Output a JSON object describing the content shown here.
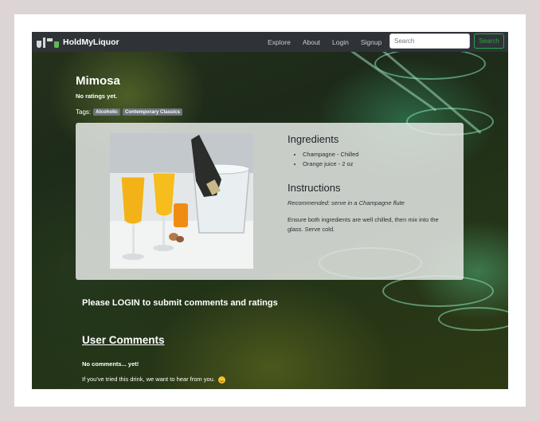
{
  "brand": {
    "name": "HoldMyLiquor",
    "icon": "cocktail-glasses-logo-icon"
  },
  "nav": {
    "links": [
      "Explore",
      "About",
      "Login",
      "Signup"
    ],
    "search_placeholder": "Search",
    "search_button": "Search"
  },
  "drink": {
    "name": "Mimosa",
    "ratings": "No ratings yet.",
    "tags_label": "Tags:",
    "tags": [
      "Alcoholic",
      "Contemporary Classics"
    ],
    "image_icon": "mimosa-photo"
  },
  "ingredients": {
    "heading": "Ingredients",
    "items": [
      "Champagne - Chilled",
      "Orange juice - 2 oz"
    ]
  },
  "instructions": {
    "heading": "Instructions",
    "recommended": "Recommended: serve in a Champagne flute",
    "text": "Ensure both ingredients are well chilled, then mix into the glass. Serve cold."
  },
  "login_prompt": "Please LOGIN to submit comments and ratings",
  "comments": {
    "heading": "User Comments",
    "empty": "No comments... yet!",
    "invite": "If you've tried this drink, we want to hear from you."
  },
  "colors": {
    "navbar": "#2f3337",
    "search_accent": "#28a745",
    "tag_badge": "#6c757d"
  }
}
